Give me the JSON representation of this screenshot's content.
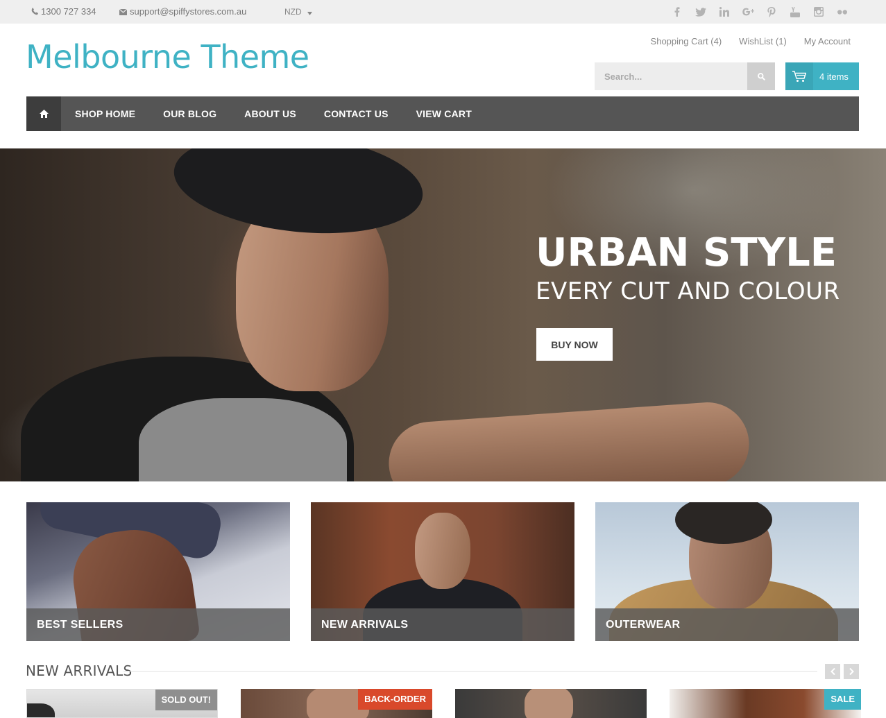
{
  "topbar": {
    "phone": "1300 727 334",
    "email": "support@spiffystores.com.au",
    "currency": "NZD",
    "social_icons": [
      "facebook-icon",
      "twitter-icon",
      "linkedin-icon",
      "google-plus-icon",
      "pinterest-icon",
      "youtube-icon",
      "instagram-icon",
      "flickr-icon"
    ]
  },
  "header": {
    "brand": "Melbourne Theme",
    "links": {
      "cart": "Shopping Cart (4)",
      "wishlist": "WishList (1)",
      "account": "My Account"
    },
    "search_placeholder": "Search...",
    "cart_items": "4 items"
  },
  "nav": {
    "items": [
      "SHOP HOME",
      "OUR BLOG",
      "ABOUT US",
      "CONTACT US",
      "VIEW CART"
    ]
  },
  "hero": {
    "title": "URBAN STYLE",
    "subtitle": "EVERY CUT AND COLOUR",
    "button": "BUY NOW"
  },
  "categories": [
    {
      "label": "BEST SELLERS"
    },
    {
      "label": "NEW ARRIVALS"
    },
    {
      "label": "OUTERWEAR"
    }
  ],
  "section": {
    "title": "NEW ARRIVALS"
  },
  "products": [
    {
      "badge": "SOLD OUT!"
    },
    {
      "badge": "BACK-ORDER"
    },
    {
      "badge": ""
    },
    {
      "badge": "SALE"
    }
  ],
  "colors": {
    "accent": "#3fb2c4",
    "nav_bg": "#555555",
    "badge_backorder": "#d9492b",
    "badge_soldout": "#8f8f8f"
  }
}
